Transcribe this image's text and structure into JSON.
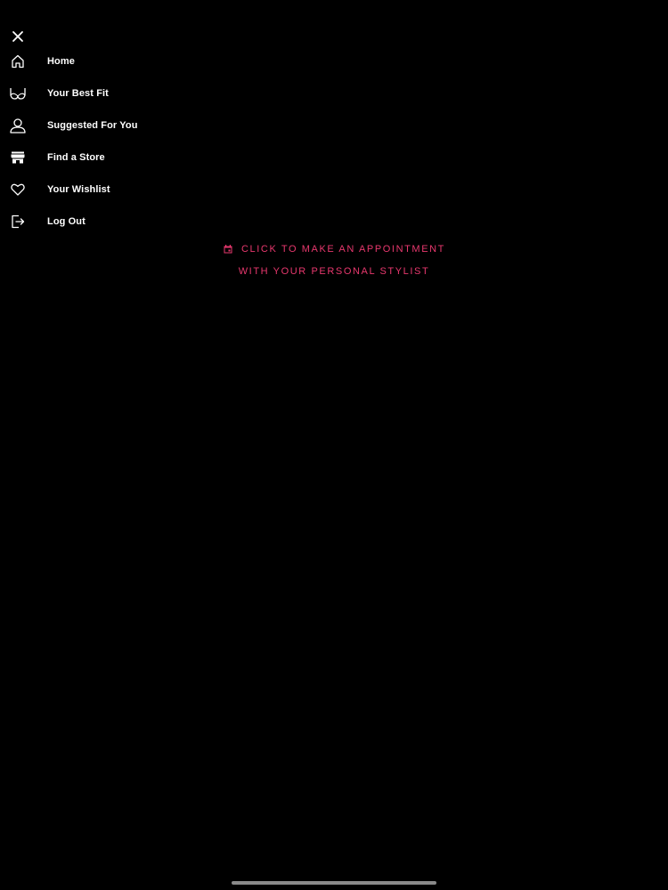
{
  "menu": {
    "close_icon": "close-icon",
    "items": [
      {
        "label": "Home",
        "icon": "home-icon"
      },
      {
        "label": "Your Best Fit",
        "icon": "bra-icon"
      },
      {
        "label": "Suggested For You",
        "icon": "person-icon"
      },
      {
        "label": "Find a Store",
        "icon": "store-icon"
      },
      {
        "label": "Your Wishlist",
        "icon": "heart-icon"
      },
      {
        "label": "Log Out",
        "icon": "logout-icon"
      }
    ]
  },
  "appointment": {
    "line1": "CLICK TO MAKE AN APPOINTMENT",
    "line2": "WITH YOUR PERSONAL STYLIST",
    "icon": "calendar-icon",
    "color": "#e8386e"
  },
  "colors": {
    "background": "#000000",
    "text": "#ffffff",
    "accent": "#e8386e"
  }
}
